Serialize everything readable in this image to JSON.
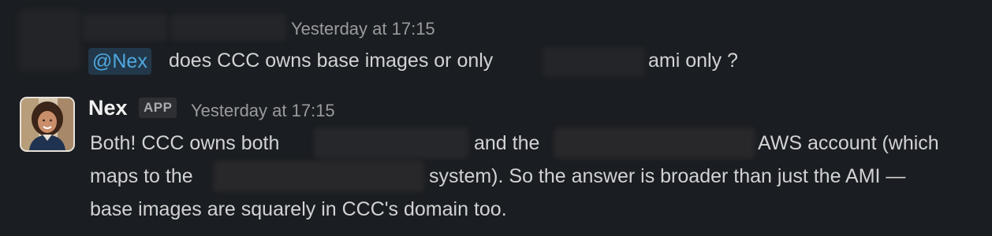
{
  "message1": {
    "timestamp": "Yesterday at 17:15",
    "mention": "@Nex",
    "text_before_redaction": "does CCC owns base images or only",
    "text_after_redaction": "ami only ?"
  },
  "message2": {
    "author": "Nex",
    "badge": "APP",
    "timestamp": "Yesterday at 17:15",
    "line1_a": "Both! CCC owns both",
    "line1_b": "and the",
    "line1_c": "AWS account (which",
    "line2_a": "maps to the",
    "line2_b": "system). So the answer is broader than just the AMI —",
    "line3": "base images are squarely in CCC's domain too."
  },
  "colors": {
    "background": "#1a1d21",
    "mention_bg": "#22384a",
    "mention_fg": "#4fa8e0",
    "timestamp": "#9a9b9d"
  }
}
